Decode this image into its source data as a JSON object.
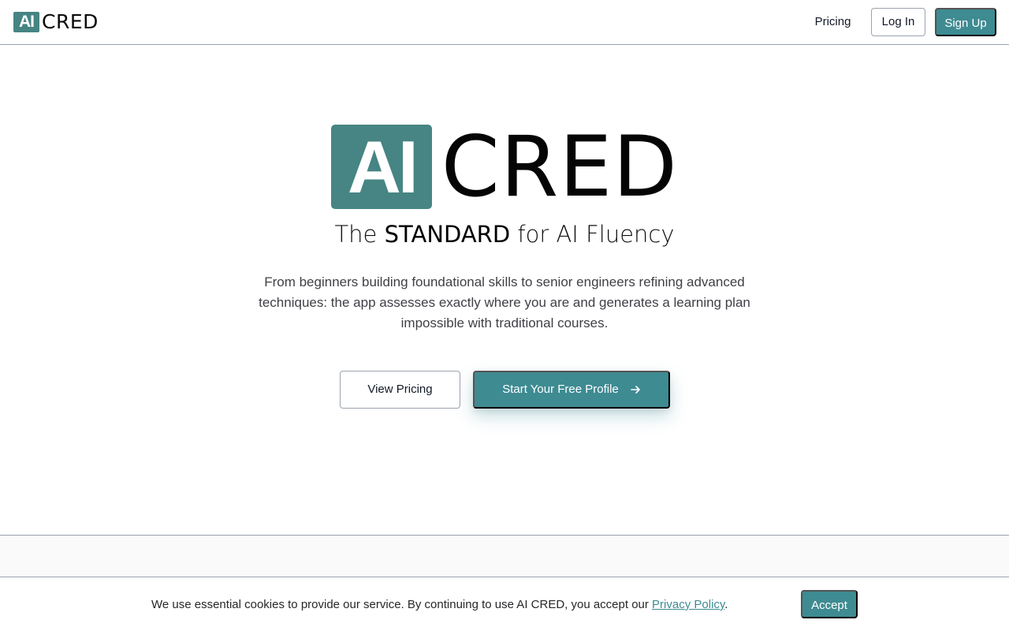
{
  "header": {
    "logo_box": "AI",
    "logo_word": "CRED",
    "nav_pricing": "Pricing",
    "login_label": "Log In",
    "signup_label": "Sign Up"
  },
  "hero": {
    "logo_box": "AI",
    "logo_word": "CRED",
    "tagline_pre": "The ",
    "tagline_strong": "STANDARD",
    "tagline_post": " for AI Fluency",
    "description": "From beginners building foundational skills to senior engineers refining advanced techniques: the app assesses exactly where you are and generates a learning plan impossible with traditional courses.",
    "view_pricing_label": "View Pricing",
    "start_label": "Start Your Free Profile",
    "start_icon": "arrow-right-icon"
  },
  "cookie": {
    "text_before": "We use essential cookies to provide our service. By continuing to use AI CRED, you accept our ",
    "link_text": "Privacy Policy",
    "text_after": ".",
    "accept_label": "Accept"
  },
  "colors": {
    "brand_teal": "#468583",
    "button_teal": "#3e8b92",
    "border_gray": "#9ca3af"
  }
}
